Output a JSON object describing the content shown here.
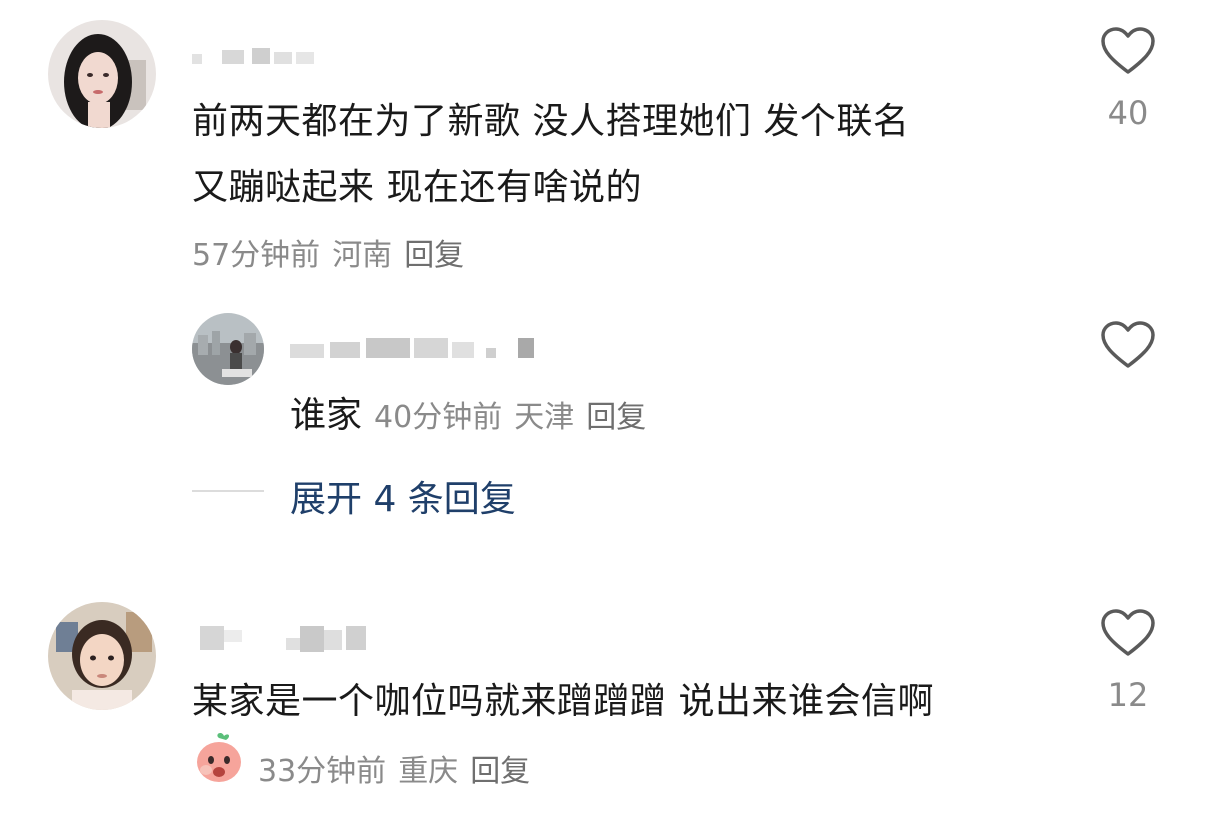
{
  "comments": [
    {
      "text_line1": "前两天都在为了新歌 没人搭理她们  发个联名",
      "text_line2": "又蹦哒起来   现在还有啥说的",
      "time": "57分钟前",
      "location": "河南",
      "reply_label": "回复",
      "likes": "40",
      "replies": [
        {
          "text": "谁家",
          "time": "40分钟前",
          "location": "天津",
          "reply_label": "回复"
        }
      ],
      "expand_label": "展开 4 条回复"
    },
    {
      "text_line1": "某家是一个咖位吗就来蹭蹭蹭 说出来谁会信啊",
      "time": "33分钟前",
      "location": "重庆",
      "reply_label": "回复",
      "likes": "12"
    }
  ],
  "colors": {
    "text": "#1a1a1a",
    "meta": "#8a8a8a",
    "expand": "#1f3f6a",
    "heart": "#5a5a5a"
  }
}
